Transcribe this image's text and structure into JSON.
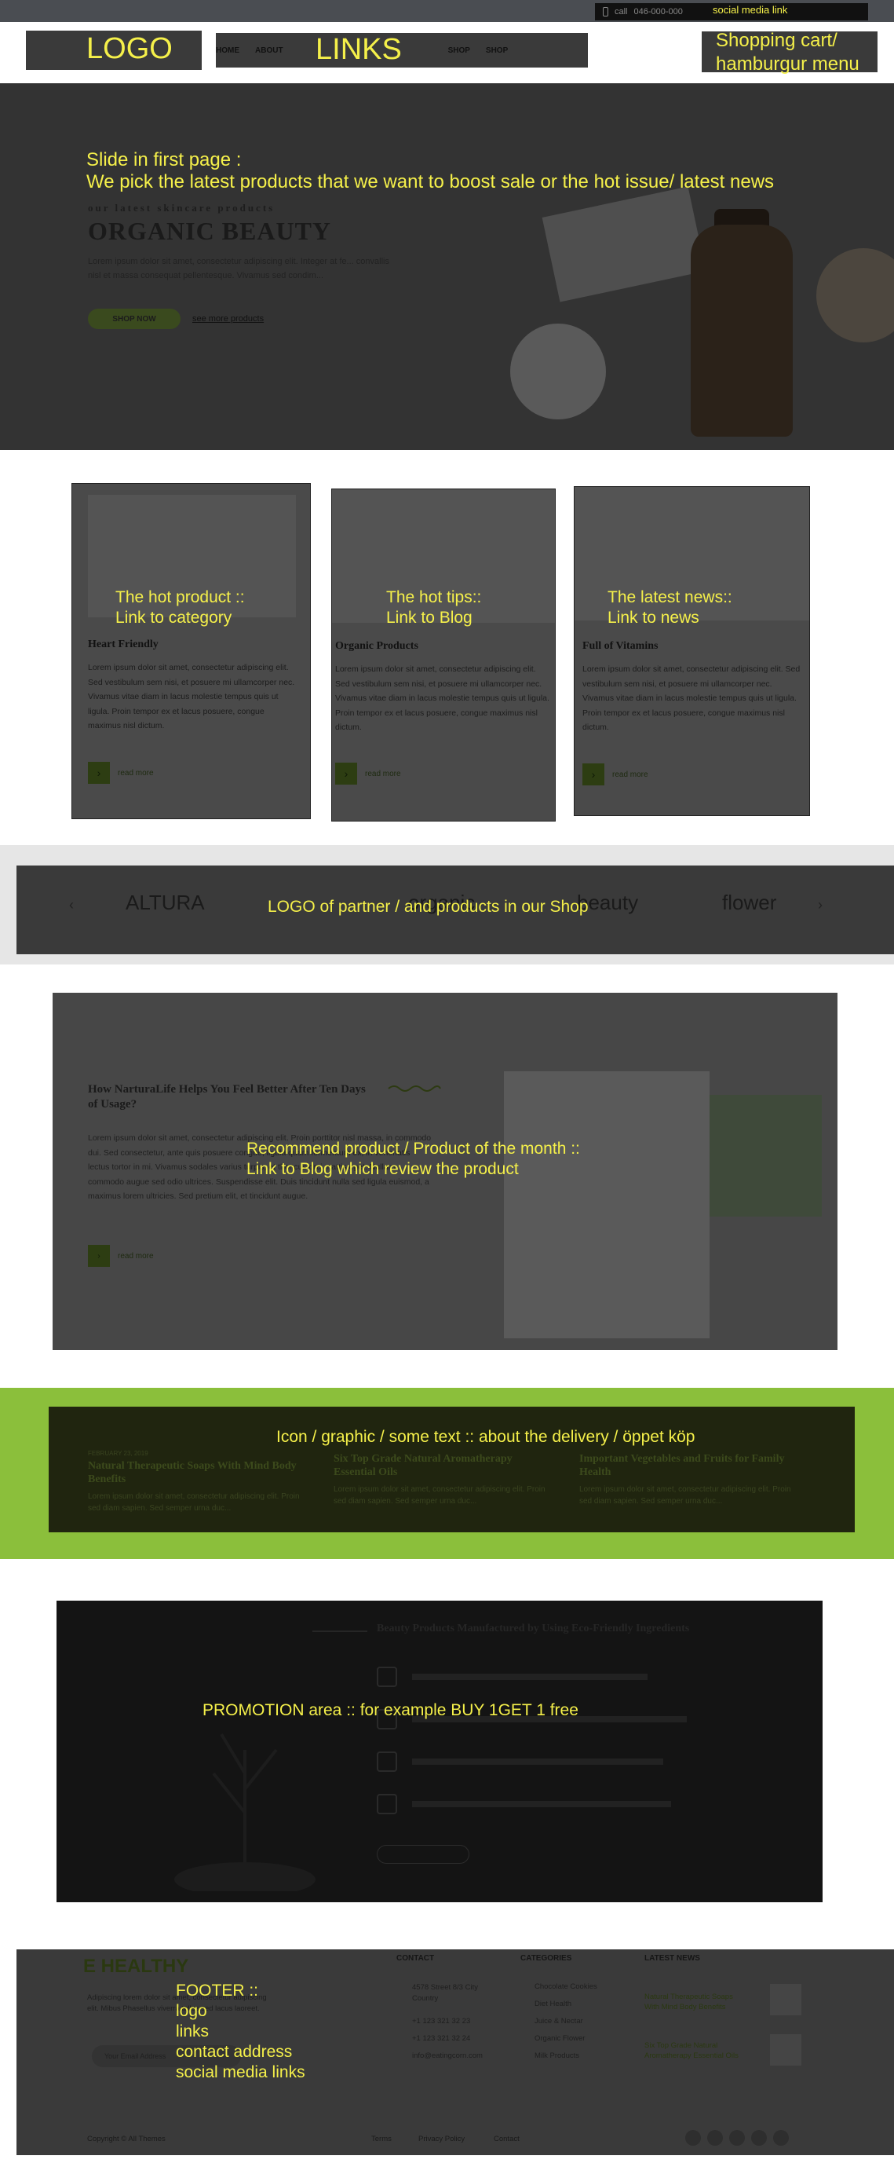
{
  "topbar": {
    "call_label": "call",
    "phone": "046-000-000",
    "social_annotation": "social media link"
  },
  "header": {
    "logo_annotation": "LOGO",
    "links_annotation": "LINKS",
    "cart_annotation": "Shopping cart/\nhamburgur menu",
    "nav": [
      "HOME",
      "ABOUT",
      "SHOP",
      "SHOP"
    ]
  },
  "hero": {
    "annotation": "Slide in first page :\nWe pick the latest products that we want to boost sale or the hot issue/ latest news",
    "subtitle": "our latest skincare products",
    "title": "ORGANIC BEAUTY",
    "text": "Lorem ipsum dolor sit amet, consectetur adipiscing elit. Integer at fe... convallis nisl et massa consequat pellentesque. Vivamus sed condim...",
    "button": "SHOP NOW",
    "link": "see more products"
  },
  "cards": [
    {
      "annotation": "The hot product ::\nLink to category",
      "title": "Heart Friendly",
      "text": "Lorem ipsum dolor sit amet, consectetur adipiscing elit. Sed vestibulum sem nisi, et posuere mi ullamcorper nec. Vivamus vitae diam in lacus molestie tempus quis ut ligula. Proin tempor ex et lacus posuere, congue maximus nisl dictum.",
      "read_more": "read more"
    },
    {
      "annotation": "The hot tips::\nLink to Blog",
      "title": "Organic Products",
      "text": "Lorem ipsum dolor sit amet, consectetur adipiscing elit. Sed vestibulum sem nisi, et posuere mi ullamcorper nec. Vivamus vitae diam in lacus molestie tempus quis ut ligula. Proin tempor ex et lacus posuere, congue maximus nisl dictum.",
      "read_more": "read more"
    },
    {
      "annotation": "The latest news::\nLink to news",
      "title": "Full of Vitamins",
      "text": "Lorem ipsum dolor sit amet, consectetur adipiscing elit. Sed vestibulum sem nisi, et posuere mi ullamcorper nec. Vivamus vitae diam in lacus molestie tempus quis ut ligula. Proin tempor ex et lacus posuere, congue maximus nisl dictum.",
      "read_more": "read more"
    }
  ],
  "partners": {
    "annotation": "LOGO of partner  / and products in our Shop",
    "logos": [
      "ALTURA",
      "organic",
      "beauty",
      "flower"
    ]
  },
  "recommend": {
    "annotation": "Recommend product / Product of the month ::\nLink to Blog which review the product",
    "title": "How NarturaLife Helps You Feel Better After Ten Days of Usage?",
    "text": "Lorem ipsum dolor sit amet, consectetur adipiscing elit. Proin porttitor nisl massa, in commodo dui. Sed consectetur, ante quis posuere congue, ligula quam fermentum ex, in venenatis lectus tortor in mi. Vivamus sodales varius turpis, et thoncus orci mattis eget. Nullam commodo augue sed odio ultrices. Suspendisse elit. Duis tincidunt nulla sed ligula euismod, a maximus lorem ultricies. Sed pretium elit, et tincidunt augue.",
    "read_more": "read more"
  },
  "delivery": {
    "annotation": "Icon / graphic / some text :: about the delivery / öppet köp",
    "posts": [
      {
        "date": "FEBRUARY 23, 2019",
        "title": "Natural Therapeutic Soaps With Mind Body Benefits",
        "text": "Lorem ipsum dolor sit amet, consectetur adipiscing elit. Proin sed diam sapien. Sed semper urna duc..."
      },
      {
        "date": "",
        "title": "Six Top Grade Natural Aromatherapy Essential Oils",
        "text": "Lorem ipsum dolor sit amet, consectetur adipiscing elit. Proin sed diam sapien. Sed semper urna duc..."
      },
      {
        "date": "",
        "title": "Important Vegetables and Fruits for Family Health",
        "text": "Lorem ipsum dolor sit amet, consectetur adipiscing elit. Proin sed diam sapien. Sed semper urna duc..."
      }
    ]
  },
  "promo": {
    "annotation": "PROMOTION area ::  for example  BUY 1GET 1 free",
    "heading": "Beauty Products Manufactured by Using Eco-Friendly Ingredients"
  },
  "footer": {
    "annotation": "FOOTER ::\nlogo\nlinks\ncontact address\nsocial media links",
    "logo": "E HEALTHY",
    "about_text": "Adipiscing lorem dolor sit amet, consectetur adipiscing elit. Mibus Phasellus viverra tellus sed lacus laoreet.",
    "newsletter_placeholder": "Your Email Address",
    "contact_heading": "CONTACT",
    "contact": [
      "4578 Street 8/3 City Country",
      "+1 123 321 32 23",
      "+1 123 321 32 24",
      "info@eatingcorn.com"
    ],
    "categories_heading": "CATEGORIES",
    "categories": [
      "Chocolate Cookies",
      "Diet Health",
      "Juice & Nectar",
      "Organic Flower",
      "Milk Products"
    ],
    "latest_heading": "LATEST NEWS",
    "latest": [
      "Natural Therapeutic Soaps With Mind Body Benefits",
      "Six Top Grade Natural Aromatherapy Essential Oils"
    ],
    "copyright": "Copyright © All Themes",
    "links": [
      "Terms",
      "Privacy Policy",
      "Contact"
    ]
  },
  "colors": {
    "accent_green": "#8bbf3b",
    "annotation_yellow": "#f5f04a",
    "overlay_dark": "#3a3a3a"
  }
}
